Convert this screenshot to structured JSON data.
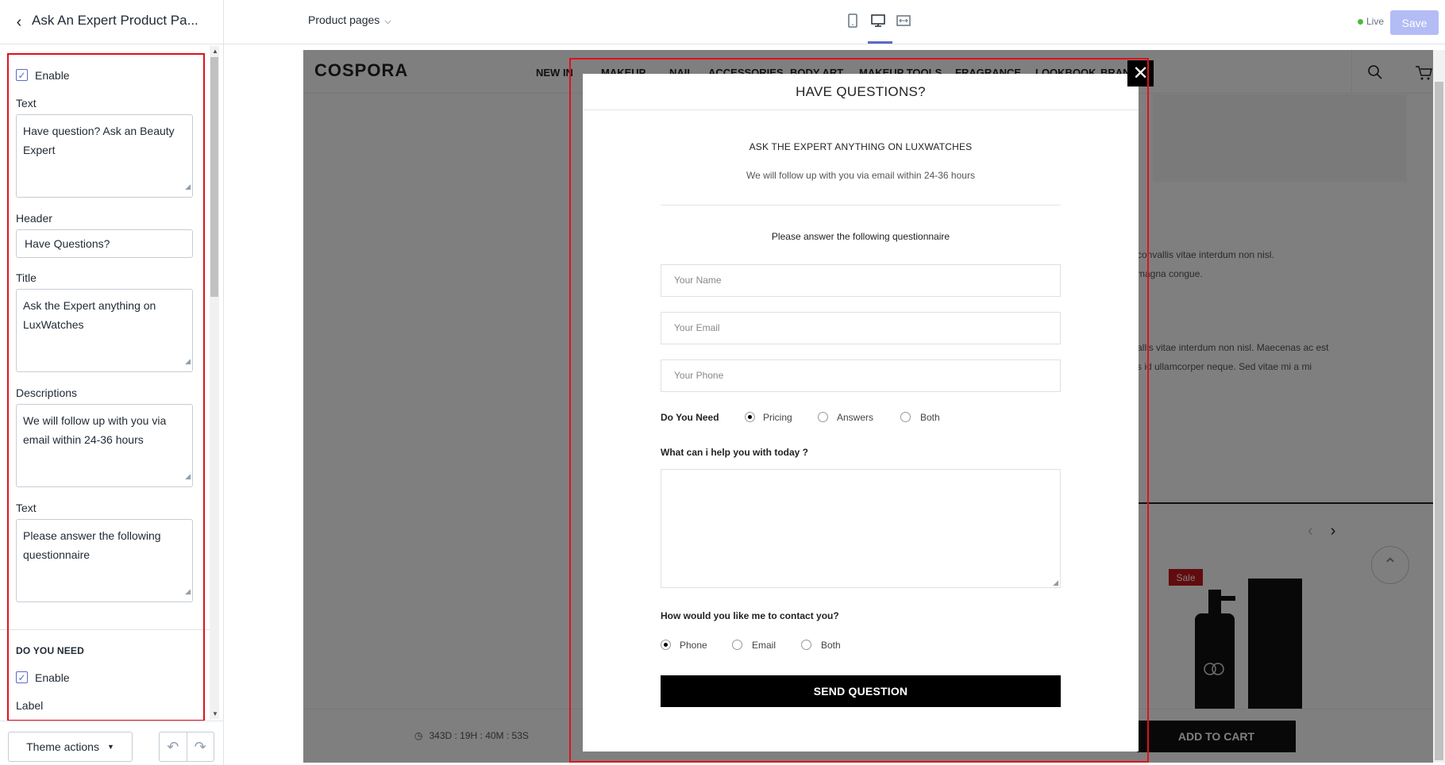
{
  "topbar": {
    "back_icon": "chevron-left-icon",
    "theme_title": "Ask An Expert Product Pa...",
    "page_select": "Product pages",
    "live_label": "Live",
    "save_label": "Save",
    "accent": "#5c6ac4"
  },
  "sidebar": {
    "enable_label": "Enable",
    "text_label": "Text",
    "text_value": "Have question? Ask an Beauty Expert",
    "header_label": "Header",
    "header_value": "Have Questions?",
    "title_label": "Title",
    "title_value": "Ask the Expert anything on LuxWatches",
    "descriptions_label": "Descriptions",
    "descriptions_value": "We will follow up with you via email within 24-36 hours",
    "text2_label": "Text",
    "text2_value": "Please answer the following questionnaire",
    "do_you_need_heading": "DO YOU NEED",
    "enable2_label": "Enable",
    "label_label": "Label",
    "theme_actions": "Theme actions"
  },
  "site": {
    "logo": "COSPORA",
    "nav": [
      "NEW IN",
      "MAKEUP",
      "NAIL",
      "ACCESSORIES",
      "BODY ART",
      "MAKEUP TOOLS",
      "FRAGRANCE",
      "LOOKBOOK",
      "BRANDS"
    ],
    "bg_text": [
      "convallis vitae interdum non nisl.",
      "magna congue.",
      "allis vitae interdum non nisl. Maecenas ac est",
      "s id ullamcorper neque. Sed vitae mi a mi"
    ],
    "sale_badge": "Sale",
    "countdown": "343D : 19H : 40M : 53S",
    "add_to_cart": "ADD TO CART"
  },
  "modal": {
    "header": "HAVE QUESTIONS?",
    "title": "ASK THE EXPERT ANYTHING ON LUXWATCHES",
    "description": "We will follow up with you via email within 24-36 hours",
    "questionnaire_text": "Please answer the following questionnaire",
    "name_placeholder": "Your Name",
    "email_placeholder": "Your Email",
    "phone_placeholder": "Your Phone",
    "do_you_need_label": "Do You Need",
    "need_options": [
      "Pricing",
      "Answers",
      "Both"
    ],
    "need_selected": "Pricing",
    "help_label": "What can i help you with today ?",
    "contact_label": "How would you like me to contact you?",
    "contact_options": [
      "Phone",
      "Email",
      "Both"
    ],
    "contact_selected": "Phone",
    "send_label": "SEND QUESTION"
  }
}
